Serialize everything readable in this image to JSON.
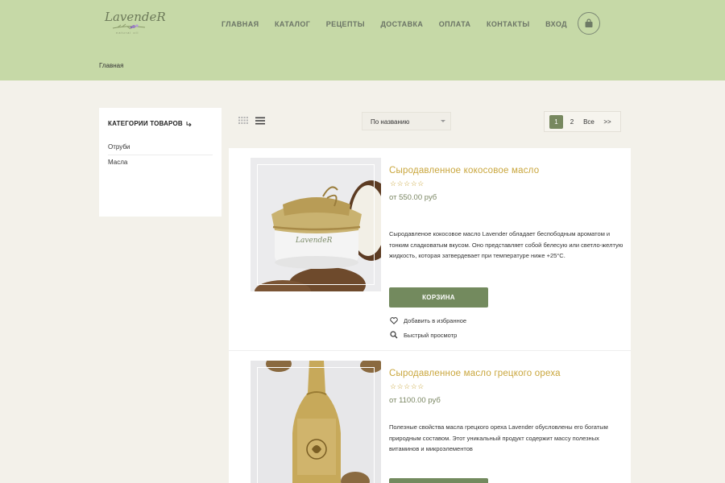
{
  "header": {
    "logo_text": "LavendeR",
    "logo_sub": "natural oil",
    "nav": [
      {
        "label": "ГЛАВНАЯ"
      },
      {
        "label": "КАТАЛОГ"
      },
      {
        "label": "РЕЦЕПТЫ"
      },
      {
        "label": "ДОСТАВКА"
      },
      {
        "label": "ОПЛАТА"
      },
      {
        "label": "КОНТАКТЫ"
      },
      {
        "label": "ВХОД"
      }
    ],
    "cart_icon": "shopping-bag-icon",
    "breadcrumb": "Главная"
  },
  "sidebar": {
    "title": "КАТЕГОРИИ ТОВАРОВ",
    "title_icon": "corner-arrow-icon",
    "categories": [
      {
        "label": "Отруби"
      },
      {
        "label": "Масла"
      }
    ]
  },
  "toolbar": {
    "grid_icon": "grid-view-icon",
    "list_icon": "list-view-icon",
    "sort_value": "По названию",
    "pagination": {
      "pages": [
        "1",
        "2"
      ],
      "current": "1",
      "all_label": "Все",
      "next_label": ">>"
    }
  },
  "products": [
    {
      "title": "Сыродавленное кокосовое масло",
      "rating_stars": "☆☆☆☆☆",
      "rating": 0,
      "price": "от 550.00 руб",
      "description": "Сыродавленое кокосовое масло Lavender обладает беспободным ароматом и тонким сладковатым вкусом. Оно представляет собой белесую или светло-желтую жидкость, которая затвердевает при температуре ниже +25°C.",
      "cart_label": "КОРЗИНА",
      "favorite_label": "Добавить в избранное",
      "quick_view_label": "Быстрый просмотр",
      "jar_label": "LavendeR"
    },
    {
      "title": "Сыродавленное масло грецкого ореха",
      "rating_stars": "☆☆☆☆☆",
      "rating": 0,
      "price": "от 1100.00 руб",
      "description": "Полезные свойства масла грецкого ореха Lavender обусловлены его богатым природным составом. Этот уникальный продукт содержит массу полезных витаминов и микроэлементов"
    }
  ],
  "colors": {
    "header_bg": "#c6d9a7",
    "page_bg": "#f3f1ea",
    "accent_gold": "#c9a63d",
    "button_green": "#738a5e",
    "price_green": "#7a8662"
  }
}
